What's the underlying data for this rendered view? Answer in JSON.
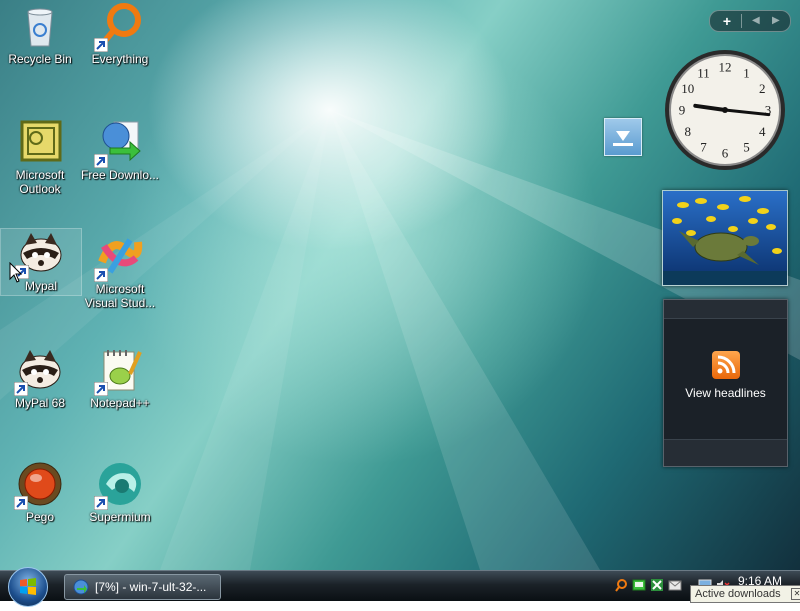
{
  "desktop": {
    "icons": [
      {
        "label": "Recycle Bin",
        "icon": "recycle-bin-icon"
      },
      {
        "label": "Everything",
        "icon": "everything-search-icon"
      },
      {
        "label": "Microsoft Outlook",
        "icon": "outlook-icon"
      },
      {
        "label": "Free Downlo...",
        "icon": "free-download-manager-icon"
      },
      {
        "label": "Mypal",
        "icon": "mypal-icon"
      },
      {
        "label": "Microsoft Visual Stud...",
        "icon": "visual-studio-icon"
      },
      {
        "label": "MyPal 68",
        "icon": "mypal68-icon"
      },
      {
        "label": "Notepad++",
        "icon": "notepad-plus-plus-icon"
      },
      {
        "label": "Pego",
        "icon": "pego-icon"
      },
      {
        "label": "Supermium",
        "icon": "supermium-icon"
      }
    ]
  },
  "sidebar": {
    "add_label": "+",
    "prev_label": "◀",
    "next_label": "▶",
    "clock": {
      "hour": 9,
      "minute": 16
    },
    "feed": {
      "label": "View headlines"
    }
  },
  "taskbar": {
    "task_button": {
      "label": "[7%] - win-7-ult-32-..."
    },
    "clock": "9:16 AM",
    "tray_tooltip": "Active downloads"
  }
}
